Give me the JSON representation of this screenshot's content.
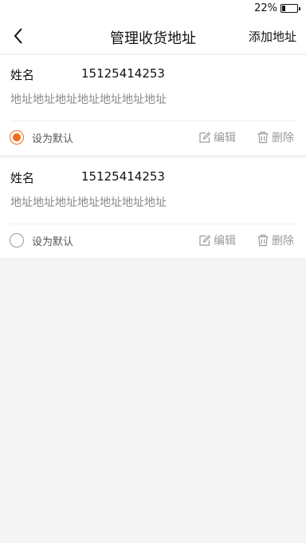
{
  "status_bar": {
    "battery_percent": "22%",
    "battery_level": 0.22
  },
  "nav": {
    "back_icon": "chevron-left-icon",
    "title": "管理收货地址",
    "add_label": "添加地址"
  },
  "addresses": [
    {
      "name": "姓名",
      "phone": "15125414253",
      "address": "地址地址地址地址地址地址地址",
      "default_label": "设为默认",
      "is_default": true,
      "edit_label": "编辑",
      "delete_label": "删除"
    },
    {
      "name": "姓名",
      "phone": "15125414253",
      "address": "地址地址地址地址地址地址地址",
      "default_label": "设为默认",
      "is_default": false,
      "edit_label": "编辑",
      "delete_label": "删除"
    }
  ],
  "colors": {
    "accent": "#f26a1b",
    "muted": "#9a9a9a",
    "background": "#f4f4f4"
  }
}
